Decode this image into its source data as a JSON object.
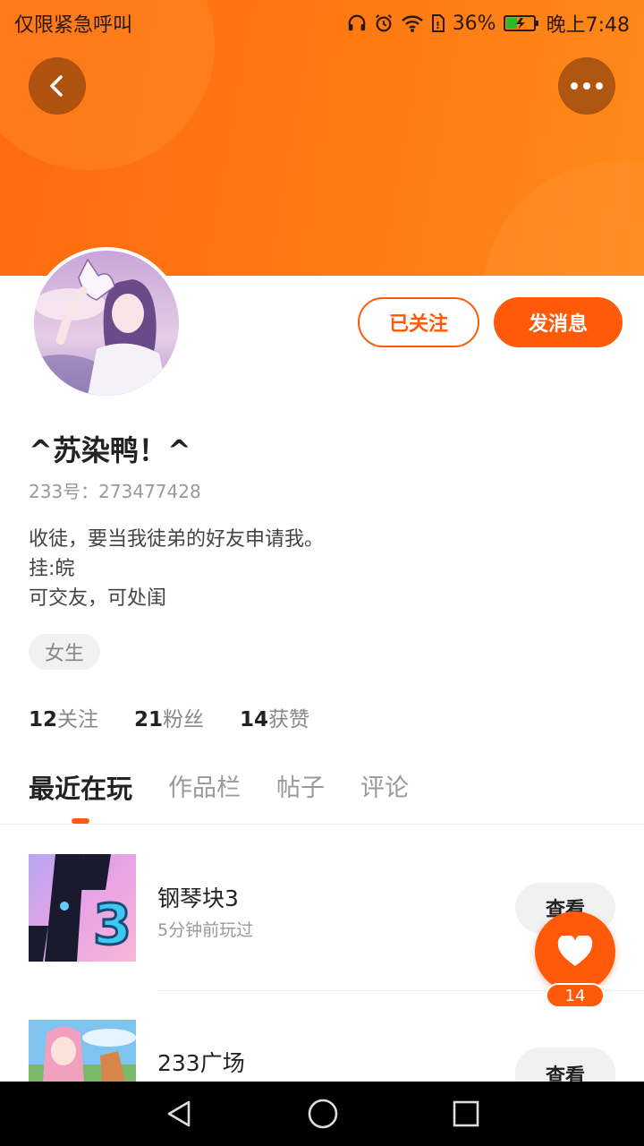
{
  "status_bar": {
    "carrier": "仅限紧急呼叫",
    "battery": "36%",
    "time": "晚上7:48"
  },
  "profile": {
    "follow_label": "已关注",
    "message_label": "发消息",
    "username": "^苏染鸭！^",
    "uid": "233号：273477428",
    "bio": [
      "收徒，要当我徒弟的好友申请我。",
      "挂:皖",
      "可交友，可处闺"
    ],
    "gender": "女生"
  },
  "stats": [
    {
      "num": "12",
      "label": "关注"
    },
    {
      "num": "21",
      "label": "粉丝"
    },
    {
      "num": "14",
      "label": "获赞"
    }
  ],
  "tabs": [
    "最近在玩",
    "作品栏",
    "帖子",
    "评论"
  ],
  "games": [
    {
      "name": "钢琴块3",
      "time": "5分钟前玩过",
      "button": "查看"
    },
    {
      "name": "233广场",
      "time": "",
      "button": "查看"
    }
  ],
  "like_fab": {
    "count": "14"
  },
  "colors": {
    "accent": "#ff5a0a",
    "header": "#ff7a12"
  }
}
